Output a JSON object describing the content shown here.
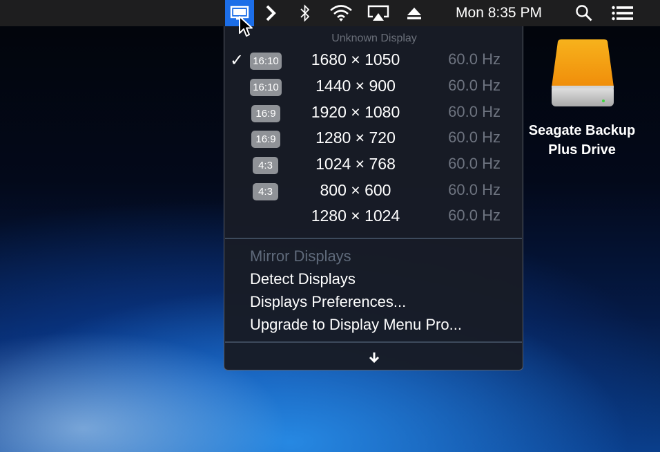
{
  "menubar": {
    "time": "Mon 8:35 PM",
    "icons": [
      "display-icon",
      "chevron-right-icon",
      "bluetooth-icon",
      "wifi-icon",
      "airplay-icon",
      "eject-icon",
      "spotlight-search-icon",
      "notification-center-icon"
    ]
  },
  "menu": {
    "header": "Unknown Display",
    "resolutions": [
      {
        "aspect": "16:10",
        "resolution": "1680 × 1050",
        "refresh": "60.0 Hz",
        "checked": true
      },
      {
        "aspect": "16:10",
        "resolution": "1440 × 900",
        "refresh": "60.0 Hz",
        "checked": false
      },
      {
        "aspect": "16:9",
        "resolution": "1920 × 1080",
        "refresh": "60.0 Hz",
        "checked": false
      },
      {
        "aspect": "16:9",
        "resolution": "1280 × 720",
        "refresh": "60.0 Hz",
        "checked": false
      },
      {
        "aspect": "4:3",
        "resolution": "1024 × 768",
        "refresh": "60.0 Hz",
        "checked": false
      },
      {
        "aspect": "4:3",
        "resolution": "800 × 600",
        "refresh": "60.0 Hz",
        "checked": false
      },
      {
        "aspect": "",
        "resolution": "1280 × 1024",
        "refresh": "60.0 Hz",
        "checked": false
      }
    ],
    "checkmark": "✓",
    "options": {
      "mirror": "Mirror Displays",
      "detect": "Detect Displays",
      "preferences": "Displays Preferences...",
      "upgrade": "Upgrade to Display Menu Pro..."
    },
    "more_glyph": "↓"
  },
  "desktop": {
    "drive_line1": "Seagate Backup",
    "drive_line2": "Plus Drive"
  },
  "colors": {
    "menubar": "#1e1e1f",
    "highlight": "#1c6ee8",
    "menu_bg": "#181c26",
    "drive_orange": "#f5a30f"
  }
}
